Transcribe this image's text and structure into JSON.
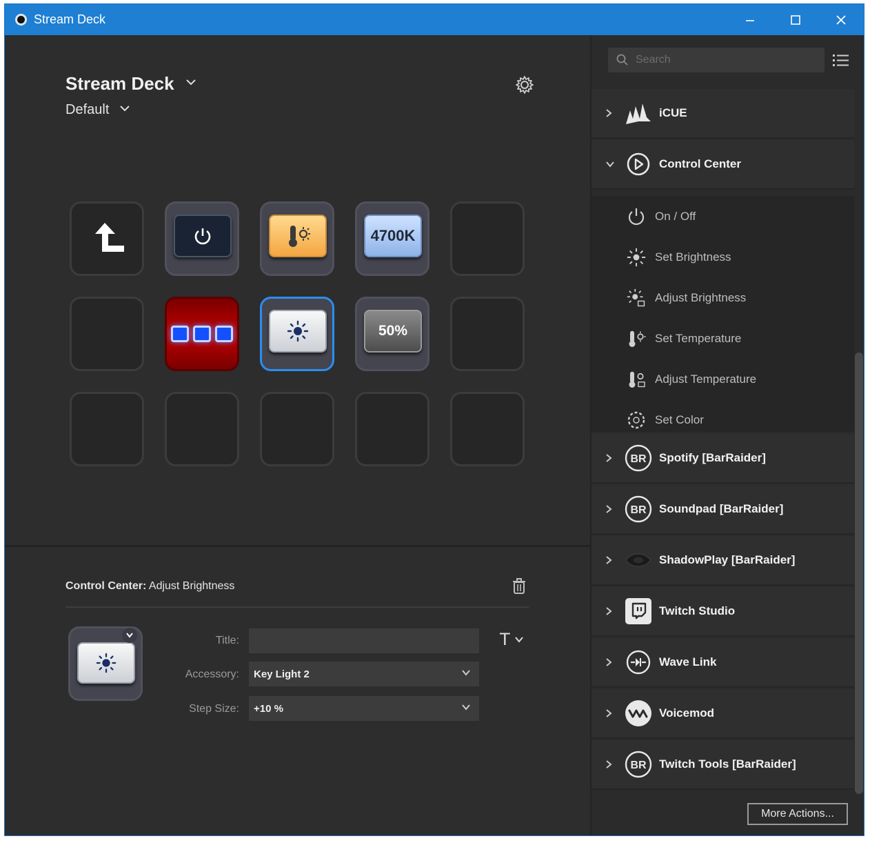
{
  "window": {
    "title": "Stream Deck"
  },
  "header": {
    "device": "Stream Deck",
    "profile": "Default"
  },
  "keys": {
    "temp_value": "4700K",
    "percent_value": "50%"
  },
  "inspector": {
    "plugin": "Control Center:",
    "action": "Adjust Brightness",
    "title_label": "Title:",
    "title_value": "",
    "accessory_label": "Accessory:",
    "accessory_value": "Key Light 2",
    "step_label": "Step Size:",
    "step_value": "+10 %",
    "text_button": "T"
  },
  "sidebar": {
    "search_placeholder": "Search",
    "categories": [
      {
        "label": "iCUE",
        "icon": "corsair-icon",
        "expanded": false
      },
      {
        "label": "Control Center",
        "icon": "elgato-icon",
        "expanded": true
      },
      {
        "label": "Spotify [BarRaider]",
        "icon": "barraider-icon",
        "expanded": false
      },
      {
        "label": "Soundpad [BarRaider]",
        "icon": "barraider-icon",
        "expanded": false
      },
      {
        "label": "ShadowPlay [BarRaider]",
        "icon": "nvidia-icon",
        "expanded": false
      },
      {
        "label": "Twitch Studio",
        "icon": "twitch-icon",
        "expanded": false
      },
      {
        "label": "Wave Link",
        "icon": "wavelink-icon",
        "expanded": false
      },
      {
        "label": "Voicemod",
        "icon": "voicemod-icon",
        "expanded": false
      },
      {
        "label": "Twitch Tools [BarRaider]",
        "icon": "barraider-icon",
        "expanded": false
      }
    ],
    "actions": [
      {
        "label": "On / Off",
        "icon": "power-icon"
      },
      {
        "label": "Set Brightness",
        "icon": "brightness-icon"
      },
      {
        "label": "Adjust Brightness",
        "icon": "adjust-brightness-icon"
      },
      {
        "label": "Set Temperature",
        "icon": "temperature-icon"
      },
      {
        "label": "Adjust Temperature",
        "icon": "adjust-temperature-icon"
      },
      {
        "label": "Set Color",
        "icon": "color-icon"
      }
    ],
    "more_actions": "More Actions..."
  },
  "colors": {
    "accent": "#1e7fd3",
    "selection": "#2a8ef0",
    "background": "#2d2d2d"
  }
}
